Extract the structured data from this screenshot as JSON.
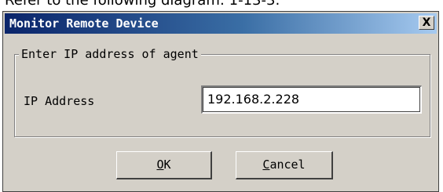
{
  "caption": "Refer to the following diagram: 1-13-3:",
  "dialog": {
    "title": "Monitor Remote Device",
    "close_label": "X",
    "group_label": "Enter IP address of agent",
    "ip_label": "IP Address",
    "ip_value": "192.168.2.228",
    "ok": {
      "mnemonic": "O",
      "rest": "K"
    },
    "cancel": {
      "mnemonic": "C",
      "rest": "ancel"
    }
  },
  "colors": {
    "face": "#d4d0c8",
    "title_start": "#0a246a",
    "title_end": "#a6caf0"
  }
}
